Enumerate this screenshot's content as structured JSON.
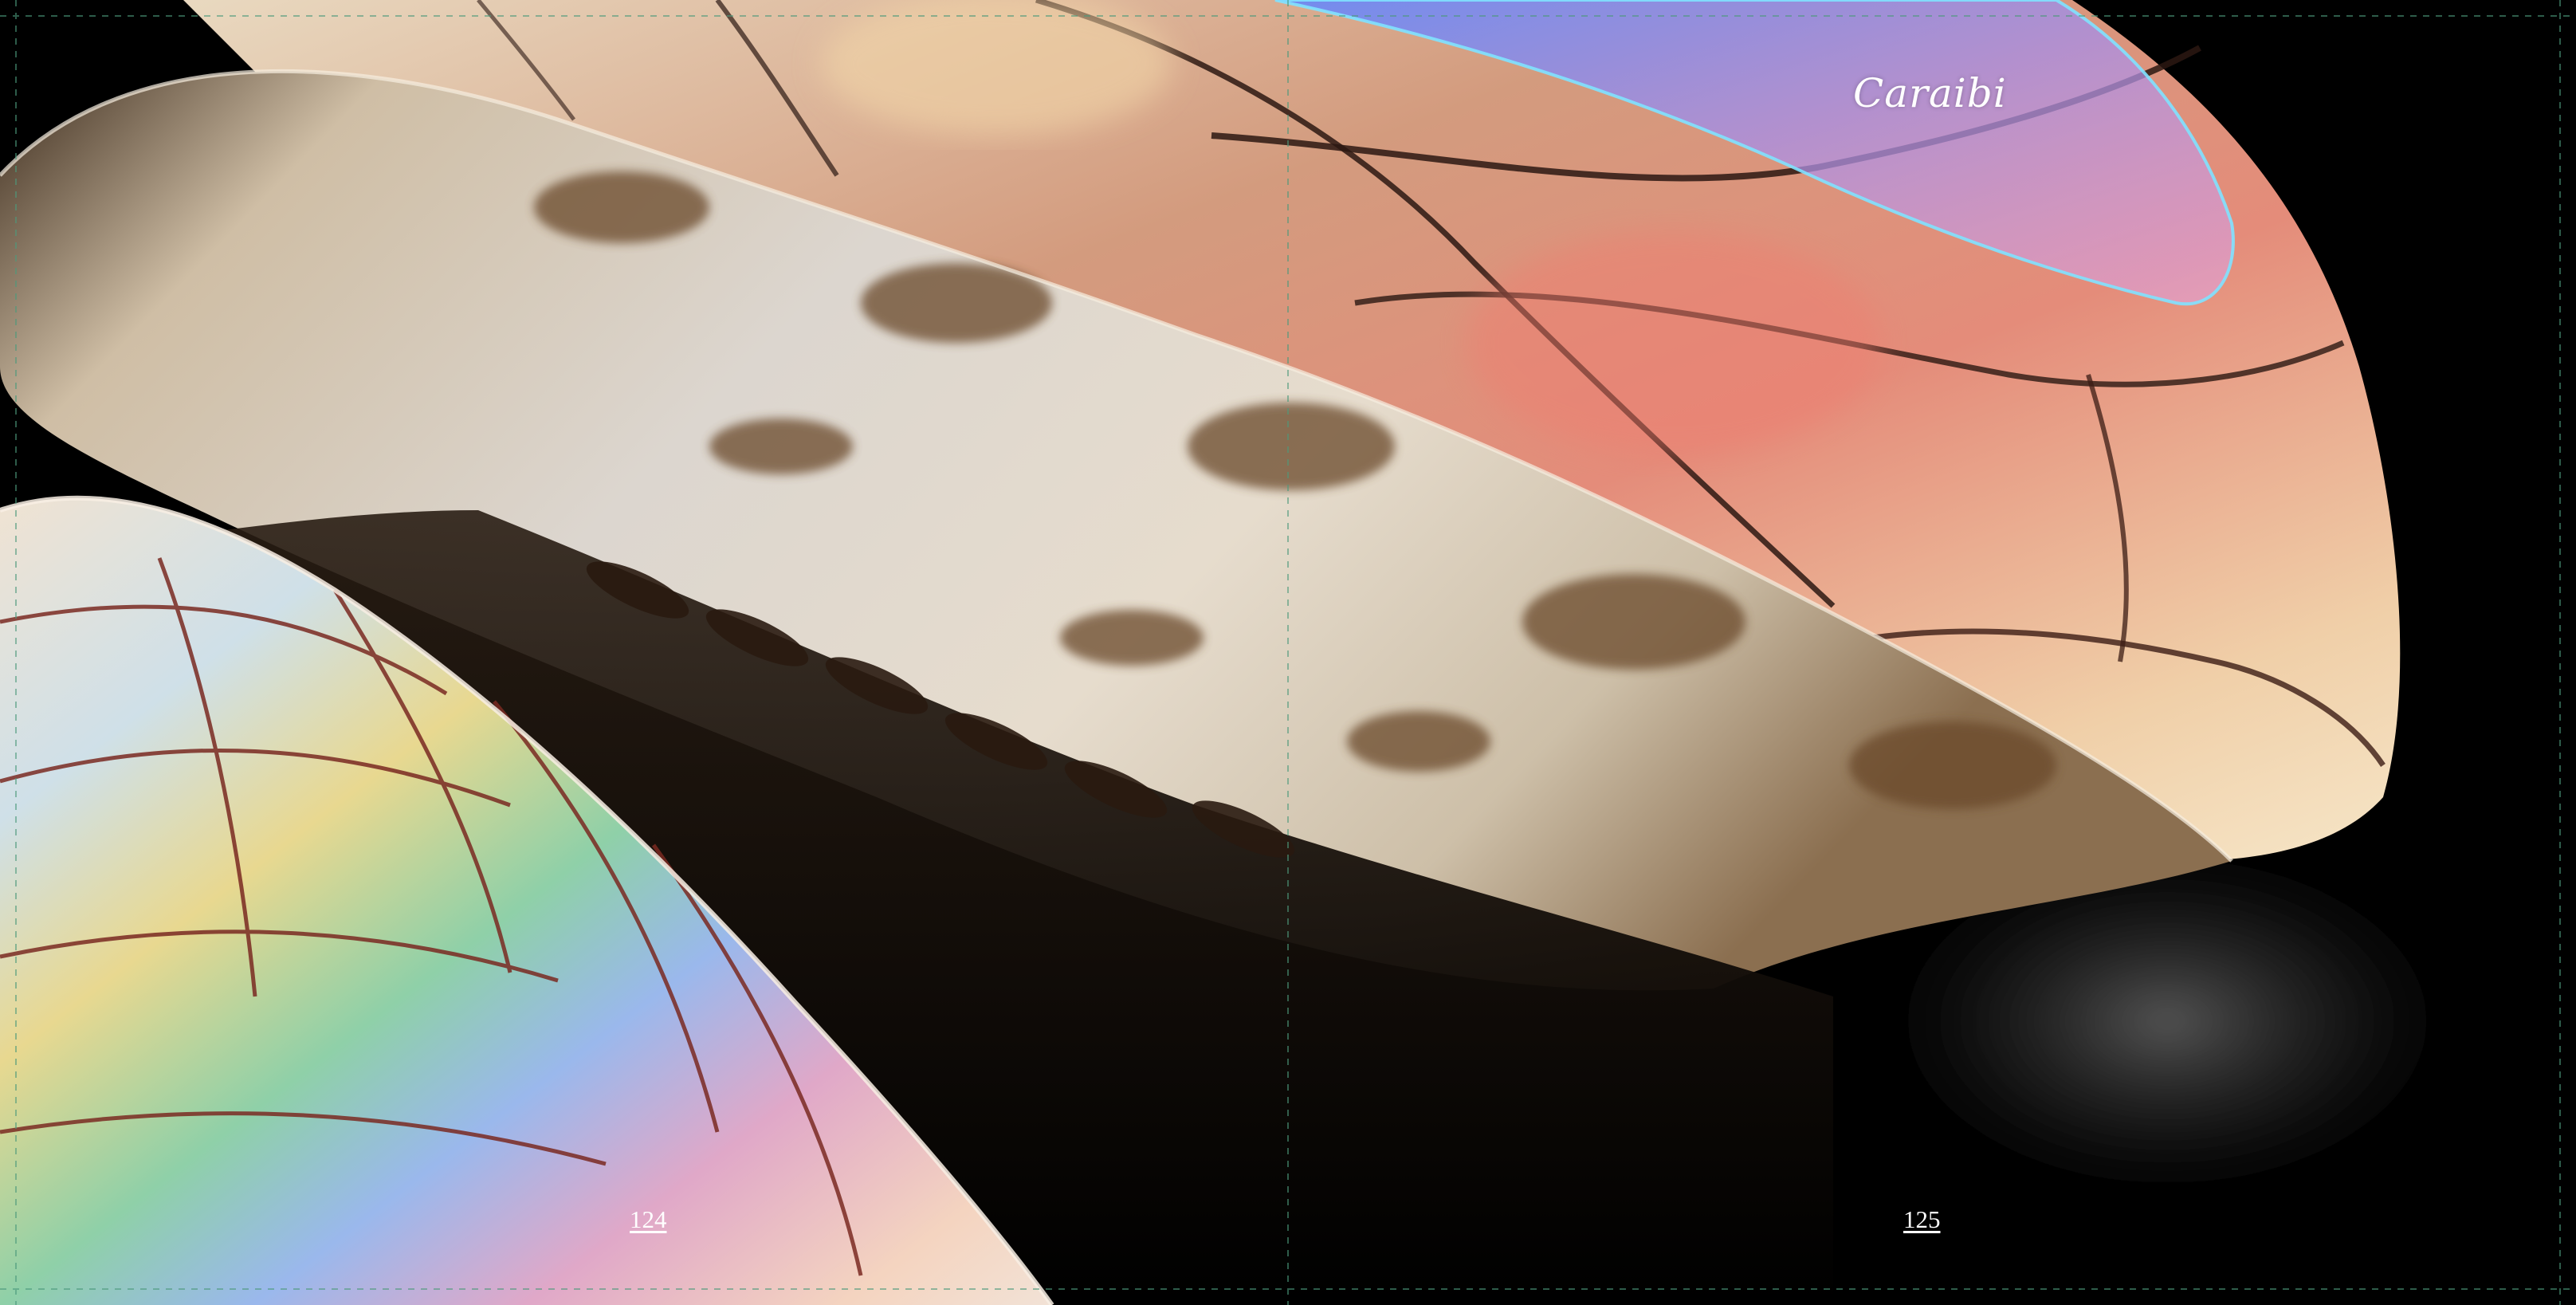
{
  "spread": {
    "title": "Caraibi",
    "left_page_number": "124",
    "right_page_number": "125"
  },
  "colors": {
    "background": "#000000",
    "text": "#ffffff",
    "shell_ivory": "#e8dcc8",
    "shell_brown": "#6b4a2a",
    "shell_pink": "#d48a78",
    "iridescent_blue": "#7aa8ff",
    "iridescent_purple": "#b48ce6"
  },
  "photo": {
    "subject": "sea-turtle-flippers-iridescent"
  }
}
